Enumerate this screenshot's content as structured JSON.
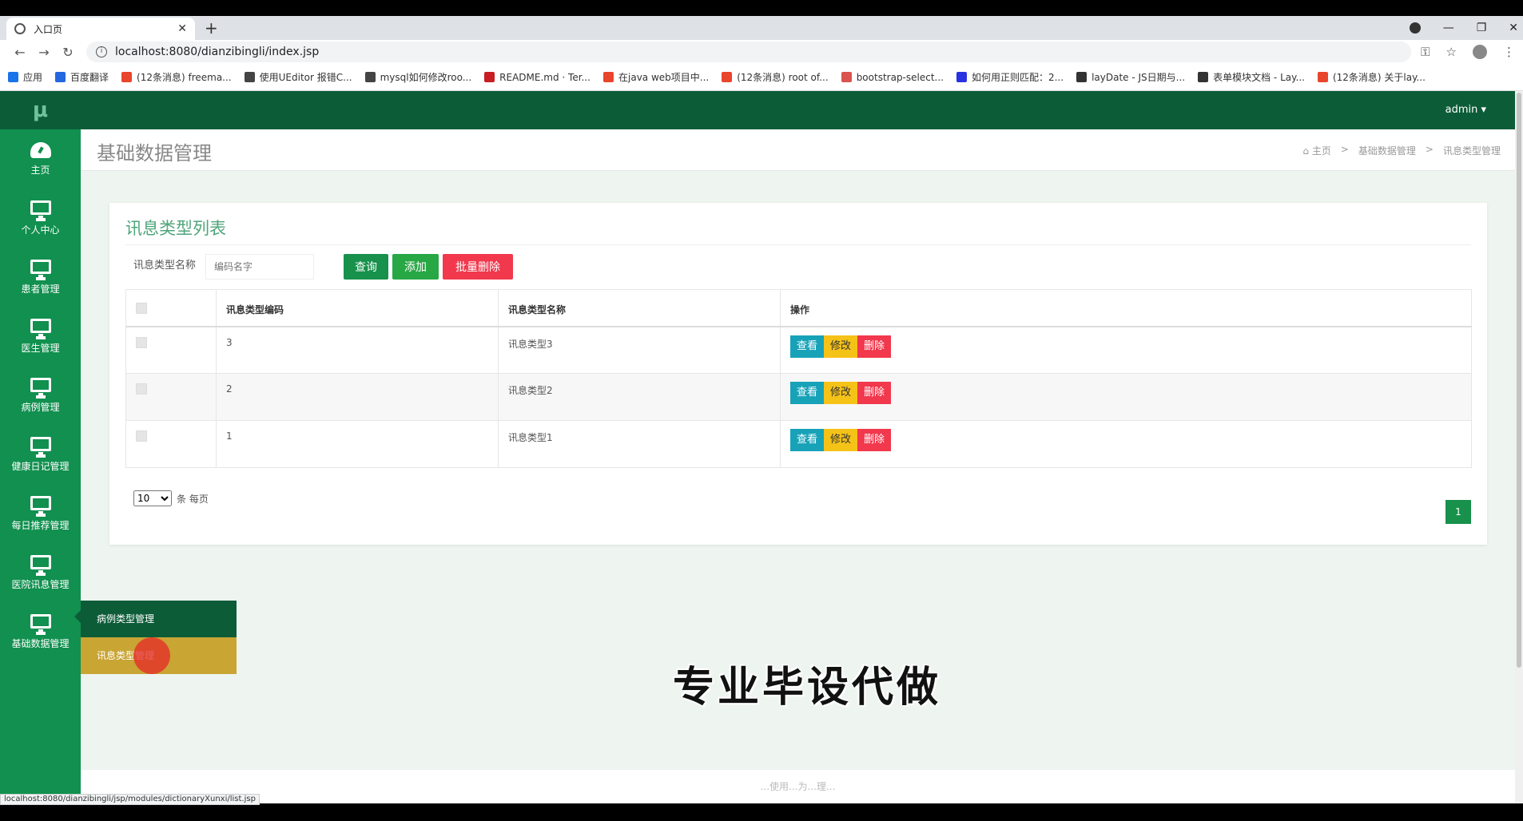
{
  "browser": {
    "tab_title": "入口页",
    "url": "localhost:8080/dianzibingli/index.jsp",
    "status_url": "localhost:8080/dianzibingli/jsp/modules/dictionaryXunxi/list.jsp",
    "bookmarks": [
      {
        "label": "应用",
        "color": "#1a73e8"
      },
      {
        "label": "百度翻译",
        "color": "#2468e0"
      },
      {
        "label": "(12条消息) freema...",
        "color": "#e8452c"
      },
      {
        "label": "使用UEditor 报错C...",
        "color": "#444444"
      },
      {
        "label": "mysql如何修改roo...",
        "color": "#444444"
      },
      {
        "label": "README.md · Ter...",
        "color": "#c71d23"
      },
      {
        "label": "在java web项目中...",
        "color": "#e8452c"
      },
      {
        "label": "(12条消息) root of...",
        "color": "#e8452c"
      },
      {
        "label": "bootstrap-select...",
        "color": "#d9534f"
      },
      {
        "label": "如何用正则匹配：2...",
        "color": "#2932e1"
      },
      {
        "label": "layDate - JS日期与...",
        "color": "#333333"
      },
      {
        "label": "表单模块文档 - Lay...",
        "color": "#333333"
      },
      {
        "label": "(12条消息) 关于lay...",
        "color": "#e8452c"
      }
    ]
  },
  "app": {
    "brand": "μ",
    "user": "admin ▾",
    "page_title": "基础数据管理",
    "breadcrumb": [
      "主页",
      ">",
      "基础数据管理",
      ">",
      "讯息类型管理"
    ],
    "sidebar": [
      {
        "label": "主页",
        "icon": "dashboard-icon"
      },
      {
        "label": "个人中心",
        "icon": "monitor-icon"
      },
      {
        "label": "患者管理",
        "icon": "monitor-icon"
      },
      {
        "label": "医生管理",
        "icon": "monitor-icon"
      },
      {
        "label": "病例管理",
        "icon": "monitor-icon"
      },
      {
        "label": "健康日记管理",
        "icon": "monitor-icon"
      },
      {
        "label": "每日推荐管理",
        "icon": "monitor-icon"
      },
      {
        "label": "医院讯息管理",
        "icon": "monitor-icon"
      },
      {
        "label": "基础数据管理",
        "icon": "monitor-icon"
      }
    ],
    "submenu": [
      "病例类型管理",
      "讯息类型管理"
    ],
    "card": {
      "title": "讯息类型列表",
      "search_label": "讯息类型名称",
      "search_placeholder": "编码名字",
      "btn_query": "查询",
      "btn_add": "添加",
      "btn_batch_delete": "批量删除",
      "columns": [
        "",
        "讯息类型编码",
        "讯息类型名称",
        "操作"
      ],
      "rows": [
        {
          "code": "3",
          "name": "讯息类型3"
        },
        {
          "code": "2",
          "name": "讯息类型2"
        },
        {
          "code": "1",
          "name": "讯息类型1"
        }
      ],
      "actions": {
        "view": "查看",
        "edit": "修改",
        "delete": "删除"
      },
      "page_size": "10",
      "page_size_suffix": "条 每页",
      "current_page": "1"
    },
    "footer": "...使用...为...理..."
  },
  "overlay": {
    "watermark": "专业毕设代做"
  }
}
